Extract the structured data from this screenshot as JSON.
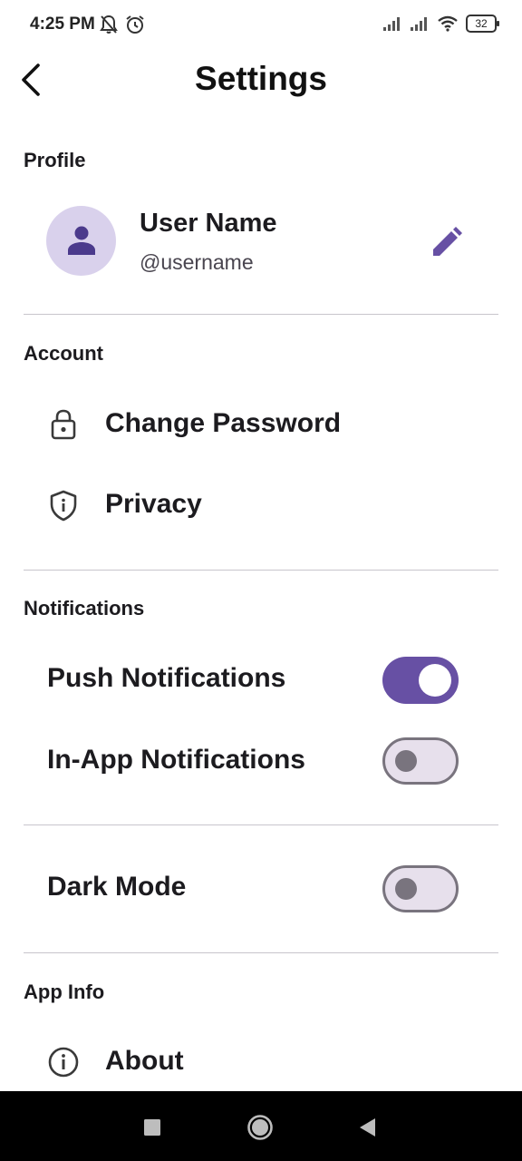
{
  "status_bar": {
    "time": "4:25 PM",
    "battery": "32",
    "icons": [
      "mute-icon",
      "alarm-icon",
      "signal-icon",
      "signal-icon",
      "wifi-icon",
      "battery-icon"
    ]
  },
  "app_bar": {
    "title": "Settings",
    "back_icon": "back-arrow-icon"
  },
  "profile": {
    "header": "Profile",
    "name": "User Name",
    "handle": "@username",
    "avatar_icon": "person-icon",
    "edit_icon": "pencil-icon"
  },
  "account": {
    "header": "Account",
    "items": [
      {
        "label": "Change Password",
        "icon": "lock-icon"
      },
      {
        "label": "Privacy",
        "icon": "shield-icon"
      }
    ]
  },
  "notifications": {
    "header": "Notifications",
    "items": [
      {
        "label": "Push Notifications",
        "enabled": true
      },
      {
        "label": "In-App Notifications",
        "enabled": false
      }
    ]
  },
  "appearance": {
    "dark_mode_label": "Dark Mode",
    "dark_mode_enabled": false
  },
  "app_info": {
    "header": "App Info",
    "items": [
      {
        "label": "About",
        "icon": "info-icon"
      }
    ]
  },
  "colors": {
    "accent": "#6750a4",
    "avatar_bg": "#d9d1ec",
    "switch_off_track": "#e7e0ec",
    "switch_off_thumb": "#79747e"
  }
}
